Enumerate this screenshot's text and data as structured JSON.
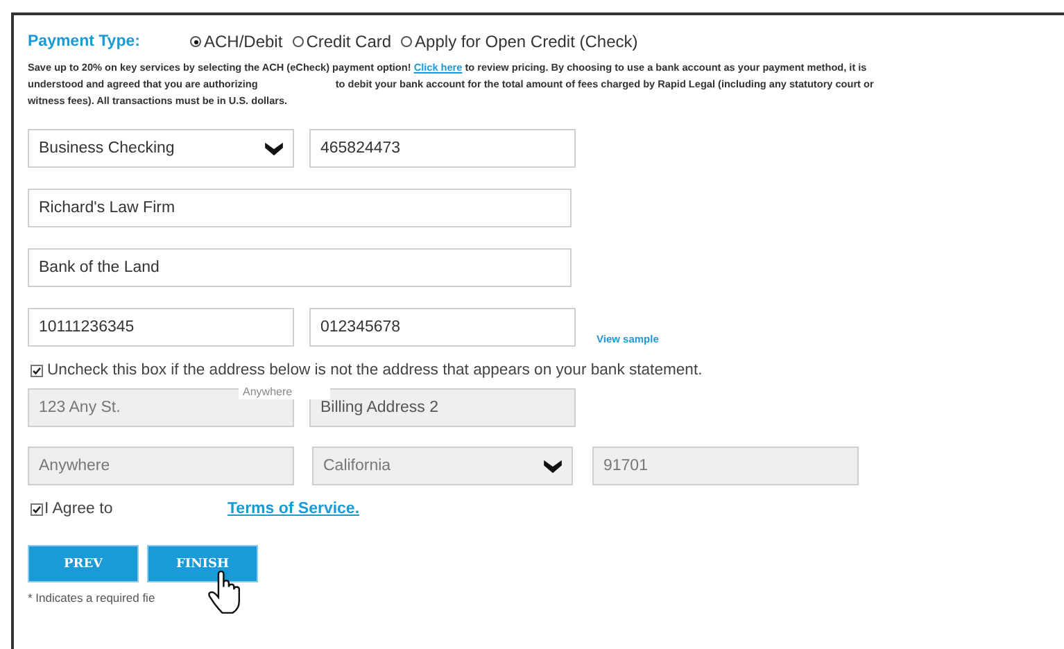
{
  "payment_type": {
    "label": "Payment Type:",
    "options": [
      {
        "label": "ACH/Debit",
        "selected": true
      },
      {
        "label": "Credit Card",
        "selected": false
      },
      {
        "label": "Apply for Open Credit (Check)",
        "selected": false
      }
    ]
  },
  "notice": {
    "before": "Save up to 20% on key services by selecting the ACH (eCheck) payment option! ",
    "link": "Click here",
    "middle": " to review pricing. By choosing to use a bank account as your payment method, it is understood and agreed that you are authorizing",
    "after": "to debit your bank account for the total amount of fees charged by Rapid Legal (including any statutory court or witness fees). All transactions must be in U.S. dollars."
  },
  "account_type": {
    "value": "Business Checking"
  },
  "account_number": {
    "value": "465824473"
  },
  "account_name": {
    "value": "Richard's Law Firm"
  },
  "bank_name": {
    "value": "Bank of the Land"
  },
  "routing_number": {
    "value": "10111236345"
  },
  "check_number": {
    "value": "012345678"
  },
  "view_sample": "View sample",
  "same_address": {
    "label": "Uncheck this box if the address below is not the address that appears on your bank statement.",
    "checked": true
  },
  "address_1": {
    "value": "123 Any St.",
    "disabled": true
  },
  "address_2": {
    "placeholder": "Billing Address 2",
    "disabled": true
  },
  "tooltip": "Anywhere",
  "city": {
    "value": "Anywhere",
    "disabled": true
  },
  "state": {
    "value": "California",
    "disabled": true
  },
  "zip": {
    "value": "91701",
    "disabled": true
  },
  "agree": {
    "label": "I Agree to",
    "link": "Terms of Service.",
    "checked": true
  },
  "buttons": [
    "PREV",
    "FINISH"
  ],
  "required_note": "* Indicates a required fie"
}
